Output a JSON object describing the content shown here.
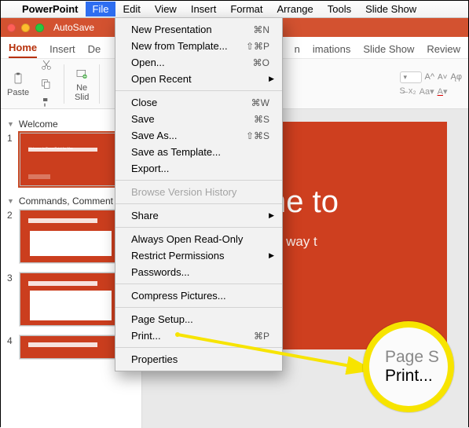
{
  "menubar": {
    "app": "PowerPoint",
    "items": [
      "File",
      "Edit",
      "View",
      "Insert",
      "Format",
      "Arrange",
      "Tools",
      "Slide Show"
    ]
  },
  "window": {
    "autosave": "AutoSave"
  },
  "ribbon_tabs": [
    "Home",
    "Insert",
    "De",
    "n",
    "imations",
    "Slide Show",
    "Review"
  ],
  "ribbon": {
    "paste": "Paste",
    "new_slide": "Ne\nSlid"
  },
  "sections": {
    "welcome": "Welcome",
    "commands": "Commands, Comment"
  },
  "thumbs": {
    "t1_line": "Welcome to PowerPoint for Mac"
  },
  "slide": {
    "title": "Welcome to",
    "sub": "5 tips for a simpler way t"
  },
  "file_menu": {
    "new_presentation": "New Presentation",
    "new_from_template": "New from Template...",
    "open": "Open...",
    "open_recent": "Open Recent",
    "close": "Close",
    "save": "Save",
    "save_as": "Save As...",
    "save_as_template": "Save as Template...",
    "export": "Export...",
    "browse_history": "Browse Version History",
    "share": "Share",
    "always_open_ro": "Always Open Read-Only",
    "restrict_perm": "Restrict Permissions",
    "passwords": "Passwords...",
    "compress": "Compress Pictures...",
    "page_setup": "Page Setup...",
    "print": "Print...",
    "properties": "Properties",
    "sc_new": "⌘N",
    "sc_new_tpl": "⇧⌘P",
    "sc_open": "⌘O",
    "sc_close": "⌘W",
    "sc_save": "⌘S",
    "sc_saveas": "⇧⌘S",
    "sc_print": "⌘P"
  },
  "zoom": {
    "line1": "Page S",
    "line2": "Print..."
  }
}
